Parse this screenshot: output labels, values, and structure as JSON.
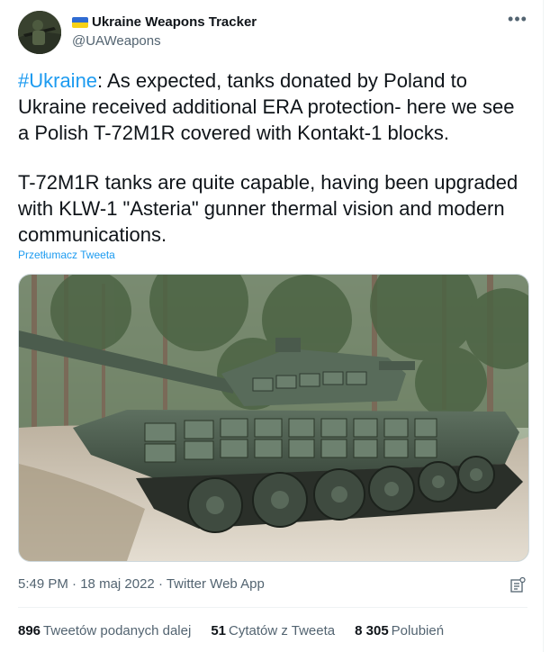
{
  "author": {
    "display_name": "Ukraine Weapons Tracker",
    "handle": "@UAWeapons",
    "flag_colors": [
      "#2f6bd2",
      "#f7d117"
    ]
  },
  "more_icon": "more-horizontal-icon",
  "tweet": {
    "hashtag": "#Ukraine",
    "line1_rest": ": As expected, tanks donated by Poland to Ukraine received additional ERA protection- here we see a Polish T-72M1R covered with Kontakt-1 blocks.",
    "paragraph2": "T-72M1R tanks are quite capable, having been upgraded with KLW-1 \"Asteria\" gunner thermal vision and modern communications.",
    "translate_label": "Przetłumacz Tweeta"
  },
  "meta": {
    "time": "5:49 PM",
    "separator": " · ",
    "date": "18 maj 2022",
    "source": "Twitter Web App"
  },
  "stats": {
    "retweets_count": "896",
    "retweets_label": "Tweetów podanych dalej",
    "quotes_count": "51",
    "quotes_label": "Cytatów z Tweeta",
    "likes_count": "8 305",
    "likes_label": "Polubień"
  },
  "colors": {
    "accent": "#1d9bf0",
    "text": "#0f1419",
    "secondary": "#536471"
  }
}
